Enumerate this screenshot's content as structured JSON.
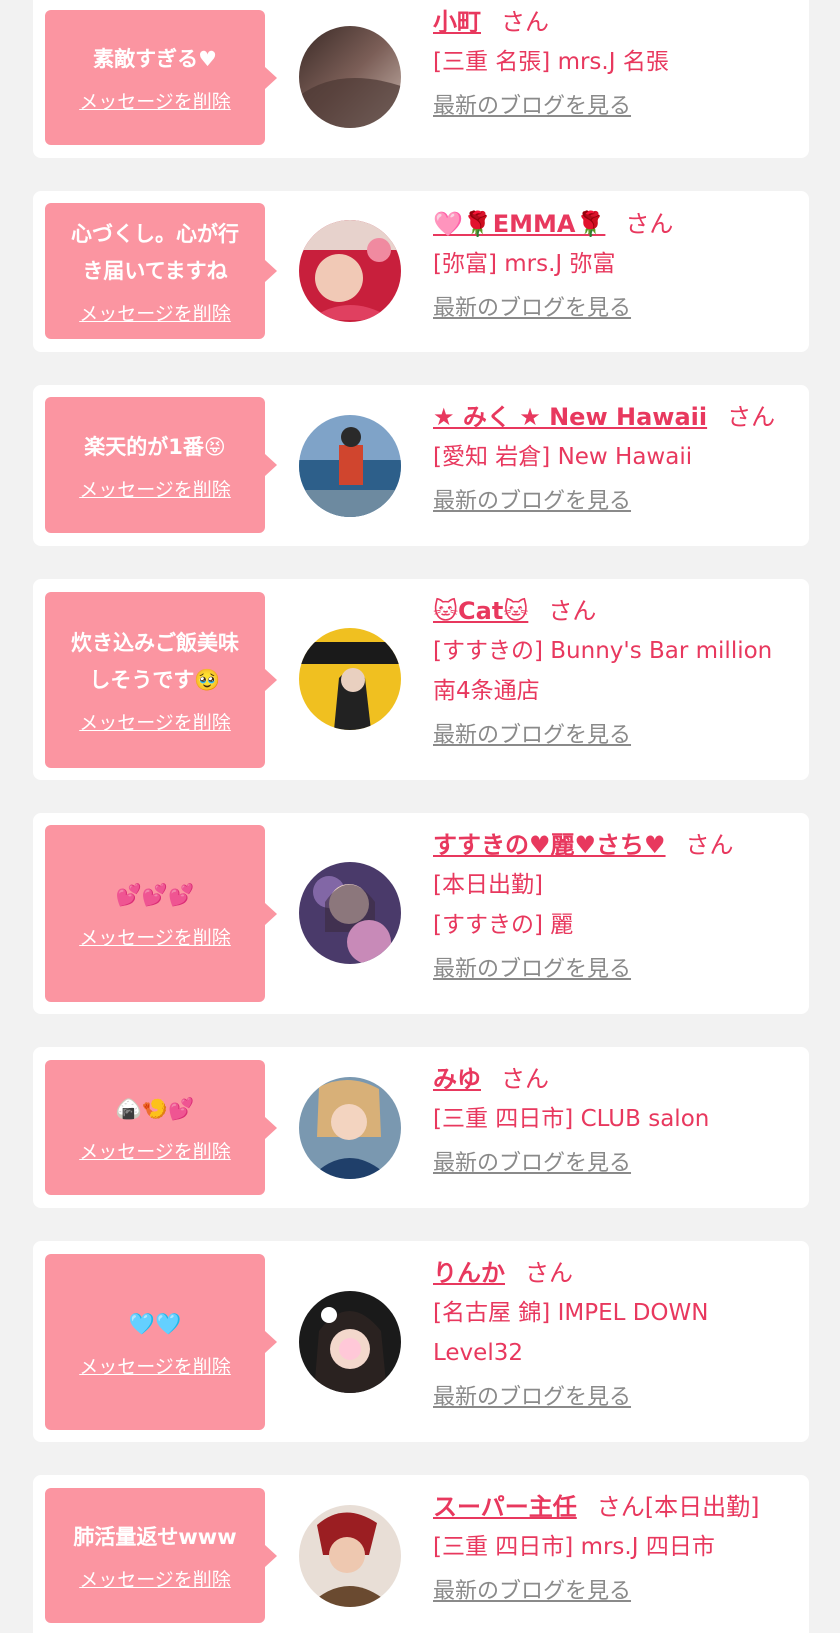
{
  "delete_label": "メッセージを削除",
  "blog_label": "最新のブログを見る",
  "san_label": "さん",
  "colors": {
    "bubble": "#fb95a1",
    "name": "#e8385e",
    "link_gray": "#8a8a8a",
    "background": "#f2f2f2"
  },
  "items": [
    {
      "message": "素敵すぎる♥",
      "name": "小町",
      "suffix": "さん",
      "shop_lines": [
        "[三重 名張] mrs.J 名張"
      ]
    },
    {
      "message": "心づくし。心が行\nき届いてますね",
      "name": "🩷🌹EMMA🌹",
      "suffix": "さん",
      "shop_lines": [
        "[弥富] mrs.J 弥富"
      ]
    },
    {
      "message": "楽天的が1番😝",
      "name": "★ みく ★ New Hawaii",
      "suffix": "さん",
      "shop_lines": [
        "[愛知 岩倉] New Hawaii"
      ]
    },
    {
      "message": "炊き込みご飯美味\nしそうです🥹",
      "name": "🐱Cat🐱",
      "suffix": "さん",
      "shop_lines": [
        "[すすきの] Bunny's Bar million",
        "南4条通店"
      ]
    },
    {
      "message": "💕💕💕",
      "name": "すすきの♥麗♥さち♥",
      "suffix": "さん",
      "shop_lines": [
        "[本日出勤]",
        "[すすきの] 麗"
      ]
    },
    {
      "message": "🍙🍤💕",
      "name": "みゆ",
      "suffix": "さん",
      "shop_lines": [
        "[三重 四日市] CLUB salon"
      ]
    },
    {
      "message": "🩵🩵",
      "name": "りんか",
      "suffix": "さん",
      "shop_lines": [
        "[名古屋 錦] IMPEL DOWN",
        "Level32"
      ]
    },
    {
      "message": "肺活量返せwww",
      "name": "スーパー主任",
      "suffix": "さん[本日出勤]",
      "shop_lines": [
        "[三重 四日市] mrs.J 四日市"
      ]
    }
  ]
}
